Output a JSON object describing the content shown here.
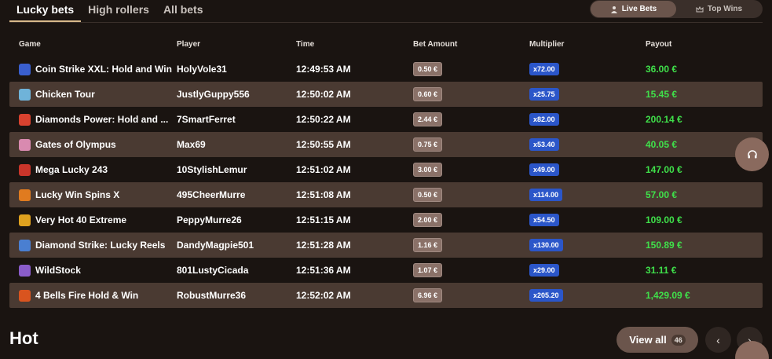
{
  "tabs": [
    {
      "label": "Lucky bets",
      "active": true
    },
    {
      "label": "High rollers",
      "active": false
    },
    {
      "label": "All bets",
      "active": false
    }
  ],
  "switcher": {
    "live_label": "Live Bets",
    "top_label": "Top Wins"
  },
  "columns": {
    "game": "Game",
    "player": "Player",
    "time": "Time",
    "bet": "Bet Amount",
    "multiplier": "Multiplier",
    "payout": "Payout"
  },
  "rows": [
    {
      "game": "Coin Strike XXL: Hold and Win",
      "player": "HolyVole31",
      "time": "12:49:53 AM",
      "bet": "0.50 €",
      "multiplier": "x72.00",
      "payout": "36.00 €",
      "icon_color": "#3a5fcf"
    },
    {
      "game": "Chicken Tour",
      "player": "JustlyGuppy556",
      "time": "12:50:02 AM",
      "bet": "0.60 €",
      "multiplier": "x25.75",
      "payout": "15.45 €",
      "icon_color": "#6fb3d9"
    },
    {
      "game": "Diamonds Power: Hold and ...",
      "player": "7SmartFerret",
      "time": "12:50:22 AM",
      "bet": "2.44 €",
      "multiplier": "x82.00",
      "payout": "200.14 €",
      "icon_color": "#d8422f"
    },
    {
      "game": "Gates of Olympus",
      "player": "Max69",
      "time": "12:50:55 AM",
      "bet": "0.75 €",
      "multiplier": "x53.40",
      "payout": "40.05 €",
      "icon_color": "#d98ab0"
    },
    {
      "game": "Mega Lucky 243",
      "player": "10StylishLemur",
      "time": "12:51:02 AM",
      "bet": "3.00 €",
      "multiplier": "x49.00",
      "payout": "147.00 €",
      "icon_color": "#c9352a"
    },
    {
      "game": "Lucky Win Spins X",
      "player": "495CheerMurre",
      "time": "12:51:08 AM",
      "bet": "0.50 €",
      "multiplier": "x114.00",
      "payout": "57.00 €",
      "icon_color": "#e07b1f"
    },
    {
      "game": "Very Hot 40 Extreme",
      "player": "PeppyMurre26",
      "time": "12:51:15 AM",
      "bet": "2.00 €",
      "multiplier": "x54.50",
      "payout": "109.00 €",
      "icon_color": "#e0a21f"
    },
    {
      "game": "Diamond Strike: Lucky Reels",
      "player": "DandyMagpie501",
      "time": "12:51:28 AM",
      "bet": "1.16 €",
      "multiplier": "x130.00",
      "payout": "150.89 €",
      "icon_color": "#4a7fd1"
    },
    {
      "game": "WildStock",
      "player": "801LustyCicada",
      "time": "12:51:36 AM",
      "bet": "1.07 €",
      "multiplier": "x29.00",
      "payout": "31.11 €",
      "icon_color": "#8a5cc9"
    },
    {
      "game": "4 Bells Fire Hold & Win",
      "player": "RobustMurre36",
      "time": "12:52:02 AM",
      "bet": "6.96 €",
      "multiplier": "x205.20",
      "payout": "1,429.09 €",
      "icon_color": "#d9541f"
    }
  ],
  "section": {
    "title": "Hot",
    "view_all_label": "View all",
    "view_all_count": "46"
  },
  "icons": {
    "live": "user-icon",
    "top": "crown-icon",
    "support": "headset-icon",
    "prev": "chevron-left-icon",
    "next": "chevron-right-icon"
  }
}
